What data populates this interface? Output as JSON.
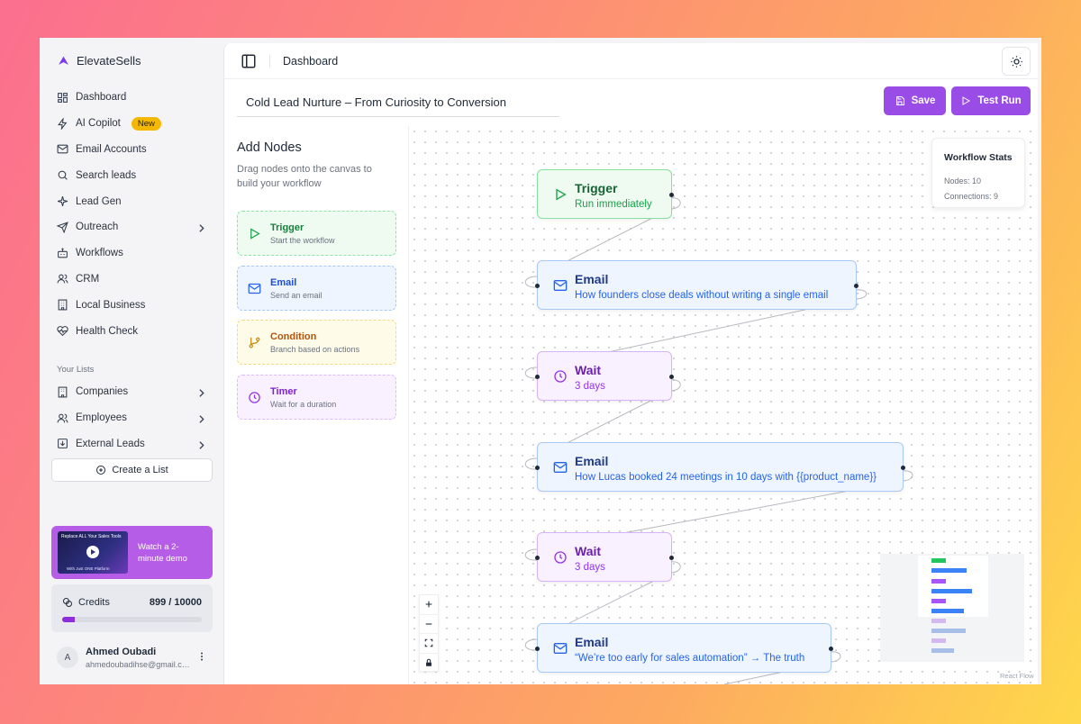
{
  "brand": {
    "name": "ElevateSells",
    "color": "#7c3aed"
  },
  "sidebar": {
    "nav": [
      {
        "label": "Dashboard",
        "icon": "dashboard-grid-icon"
      },
      {
        "label": "AI Copilot",
        "icon": "zap-icon",
        "badge": "New"
      },
      {
        "label": "Email Accounts",
        "icon": "mail-icon"
      },
      {
        "label": "Search leads",
        "icon": "search-icon"
      },
      {
        "label": "Lead Gen",
        "icon": "sparkle-icon"
      },
      {
        "label": "Outreach",
        "icon": "send-icon",
        "chevron": true
      },
      {
        "label": "Workflows",
        "icon": "bot-icon"
      },
      {
        "label": "CRM",
        "icon": "users-icon"
      },
      {
        "label": "Local Business",
        "icon": "building-icon"
      },
      {
        "label": "Health Check",
        "icon": "heart-pulse-icon"
      }
    ],
    "lists_label": "Your Lists",
    "lists": [
      {
        "label": "Companies",
        "icon": "building-icon"
      },
      {
        "label": "Employees",
        "icon": "users-icon"
      },
      {
        "label": "External Leads",
        "icon": "import-icon"
      }
    ],
    "create_list": "Create a List",
    "demo": {
      "text": "Watch a 2-minute demo",
      "thumb_title": "Replace ALL Your Sales Tools",
      "thumb_sub": "With Just ONE Platform"
    },
    "credits": {
      "label": "Credits",
      "value": "899 / 10000",
      "fraction": 0.0899
    },
    "user": {
      "initial": "A",
      "name": "Ahmed Oubadi",
      "email": "ahmedoubadihse@gmail.com"
    }
  },
  "topbar": {
    "breadcrumb": "Dashboard"
  },
  "workflow": {
    "title": "Cold Lead Nurture – From Curiosity to Conversion",
    "save_label": "Save",
    "test_run_label": "Test Run"
  },
  "palette": {
    "title": "Add Nodes",
    "description": "Drag nodes onto the canvas to build your workflow",
    "nodes": [
      {
        "title": "Trigger",
        "sub": "Start the workflow",
        "color": "#16a34a"
      },
      {
        "title": "Email",
        "sub": "Send an email",
        "color": "#2563eb"
      },
      {
        "title": "Condition",
        "sub": "Branch based on actions",
        "color": "#ca8a04"
      },
      {
        "title": "Timer",
        "sub": "Wait for a duration",
        "color": "#9333ea"
      }
    ]
  },
  "canvas": {
    "stats": {
      "title": "Workflow Stats",
      "nodes": "Nodes: 10",
      "connections": "Connections: 9"
    },
    "nodes": [
      {
        "type": "trigger",
        "title": "Trigger",
        "sub": "Run immediately"
      },
      {
        "type": "email",
        "title": "Email",
        "sub": "How founders close deals without writing a single email"
      },
      {
        "type": "wait",
        "title": "Wait",
        "sub": "3 days"
      },
      {
        "type": "email",
        "title": "Email",
        "sub": "How Lucas booked 24 meetings in 10 days with {{product_name}}"
      },
      {
        "type": "wait",
        "title": "Wait",
        "sub": "3 days"
      },
      {
        "type": "email",
        "title": "Email",
        "sub": "“We’re too early for sales automation” → The truth"
      }
    ],
    "attribution": "React Flow"
  },
  "colors": {
    "accent": "#9a4de6",
    "trigger_bg": "#effaf1",
    "trigger_border": "#86e1a1",
    "trigger_text": "#15803d",
    "email_bg": "#eff5ff",
    "email_border": "#a9c8f5",
    "email_text": "#1d4ed8",
    "wait_bg": "#f9f1ff",
    "wait_border": "#d7b4f5",
    "wait_text": "#7e22ce"
  }
}
